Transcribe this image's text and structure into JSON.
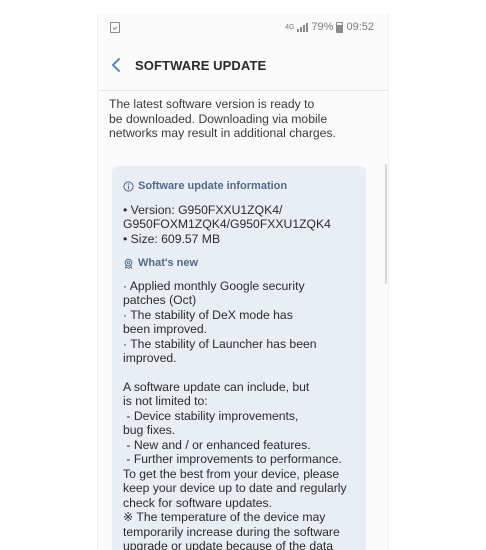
{
  "status_bar": {
    "network": "4G",
    "battery_percent": "79%",
    "time": "09:52",
    "signal_bars_filled": 4
  },
  "app_bar": {
    "title": "SOFTWARE UPDATE"
  },
  "intro_lines": [
    "The latest software version is ready to",
    "be downloaded. Downloading via mobile",
    "networks may result in additional charges."
  ],
  "info_section": {
    "header": "Software update information",
    "lines": [
      "• Version: G950FXXU1ZQK4/",
      "G950FOXM1ZQK4/G950FXXU1ZQK4",
      "• Size: 609.57 MB"
    ]
  },
  "whats_new": {
    "header": "What's new",
    "lines": [
      "· Applied monthly Google security",
      "patches (Oct)",
      "· The stability of DeX mode has",
      "been improved.",
      "· The stability of Launcher has been",
      "improved."
    ]
  },
  "general_info": {
    "lines": [
      "A software update can include, but",
      "is not limited to:",
      " - Device stability improvements,",
      "bug fixes.",
      " - New and / or enhanced features.",
      " - Further improvements to performance.",
      "To get the best from your device, please",
      "keep your device up to date and regularly",
      "check for software updates.",
      "※ The temperature of the device may",
      "temporarily increase during the software",
      "upgrade or update because of the data"
    ]
  },
  "colors": {
    "accent": "#4f6b88",
    "card_background": "#e9eef4",
    "back_arrow": "#3f7fc2"
  }
}
